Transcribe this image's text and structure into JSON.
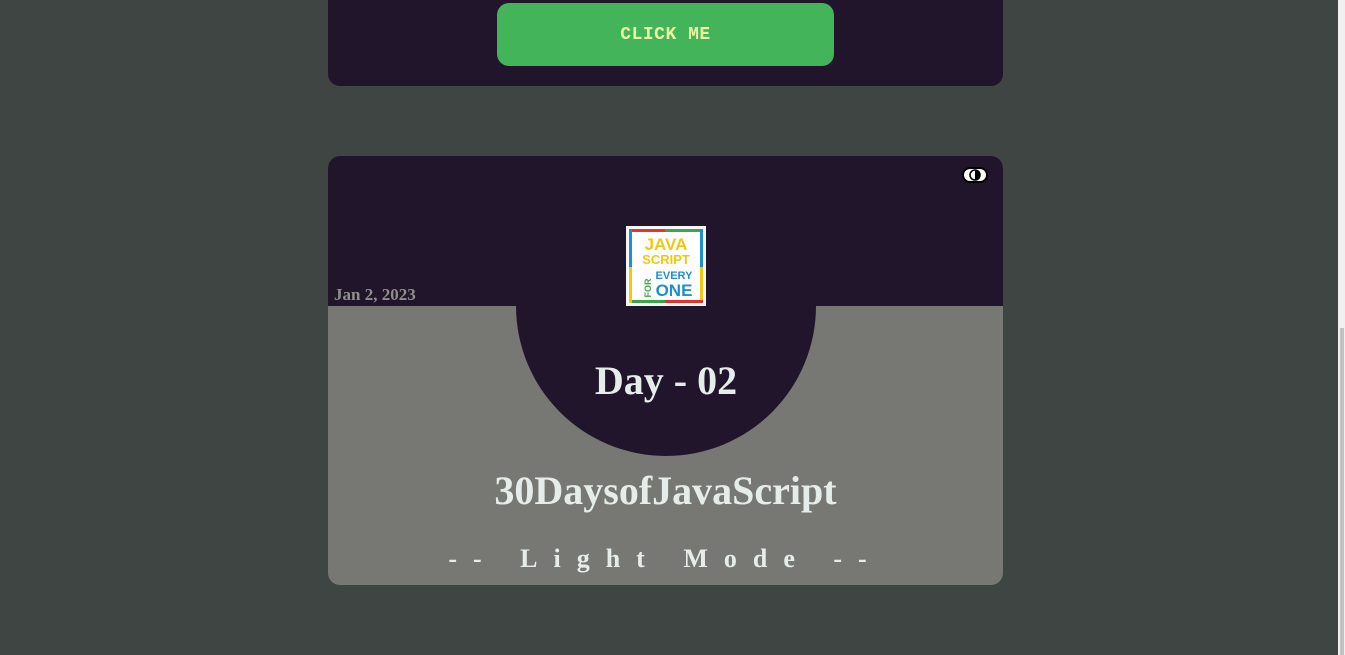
{
  "top_card": {
    "button_label": "CLICK ME"
  },
  "card": {
    "date": "Jan 2, 2023",
    "day_title": "Day - 02",
    "title": "30DaysofJavaScript",
    "mode_toggle_text": "-- Light Mode --",
    "logo": {
      "line1": "JAVA",
      "line2": "SCRIPT",
      "for": "FOR",
      "every": "EVERY",
      "one": "ONE"
    },
    "toggle_icon": "contrast-icon"
  },
  "colors": {
    "page_background": "#3e4543",
    "card_dark": "#21152c",
    "card_light": "#777873",
    "button_green": "#44b45a",
    "button_text": "#e8f5a0",
    "title_text": "#e6ecea"
  }
}
